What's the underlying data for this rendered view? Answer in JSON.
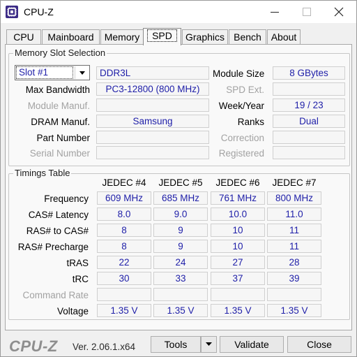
{
  "window": {
    "title": "CPU-Z"
  },
  "tabs": [
    {
      "label": "CPU"
    },
    {
      "label": "Mainboard"
    },
    {
      "label": "Memory"
    },
    {
      "label": "SPD"
    },
    {
      "label": "Graphics"
    },
    {
      "label": "Bench"
    },
    {
      "label": "About"
    }
  ],
  "active_tab": "SPD",
  "memory_slot": {
    "title": "Memory Slot Selection",
    "slot_selected": "Slot #1",
    "memory_type": "DDR3L",
    "module_size_label": "Module Size",
    "module_size": "8 GBytes",
    "max_bandwidth_label": "Max Bandwidth",
    "max_bandwidth": "PC3-12800 (800 MHz)",
    "spd_ext_label": "SPD Ext.",
    "spd_ext": "",
    "module_manuf_label": "Module Manuf.",
    "module_manuf": "",
    "week_year_label": "Week/Year",
    "week_year": "19 / 23",
    "dram_manuf_label": "DRAM Manuf.",
    "dram_manuf": "Samsung",
    "ranks_label": "Ranks",
    "ranks": "Dual",
    "part_number_label": "Part Number",
    "part_number": "",
    "correction_label": "Correction",
    "correction": "",
    "serial_number_label": "Serial Number",
    "serial_number": "",
    "registered_label": "Registered",
    "registered": ""
  },
  "timings": {
    "title": "Timings Table",
    "columns": [
      "JEDEC #4",
      "JEDEC #5",
      "JEDEC #6",
      "JEDEC #7"
    ],
    "rows": [
      {
        "label": "Frequency",
        "values": [
          "609 MHz",
          "685 MHz",
          "761 MHz",
          "800 MHz"
        ]
      },
      {
        "label": "CAS# Latency",
        "values": [
          "8.0",
          "9.0",
          "10.0",
          "11.0"
        ]
      },
      {
        "label": "RAS# to CAS#",
        "values": [
          "8",
          "9",
          "10",
          "11"
        ]
      },
      {
        "label": "RAS# Precharge",
        "values": [
          "8",
          "9",
          "10",
          "11"
        ]
      },
      {
        "label": "tRAS",
        "values": [
          "22",
          "24",
          "27",
          "28"
        ]
      },
      {
        "label": "tRC",
        "values": [
          "30",
          "33",
          "37",
          "39"
        ]
      },
      {
        "label": "Command Rate",
        "values": [
          "",
          "",
          "",
          ""
        ]
      },
      {
        "label": "Voltage",
        "values": [
          "1.35 V",
          "1.35 V",
          "1.35 V",
          "1.35 V"
        ]
      }
    ]
  },
  "footer": {
    "logo": "CPU-Z",
    "version": "Ver. 2.06.1.x64",
    "tools_label": "Tools",
    "validate_label": "Validate",
    "close_label": "Close"
  },
  "colors": {
    "value_text": "#1e1ea8",
    "disabled_text": "#a2a2a2",
    "app_icon": "#3b2a86"
  }
}
